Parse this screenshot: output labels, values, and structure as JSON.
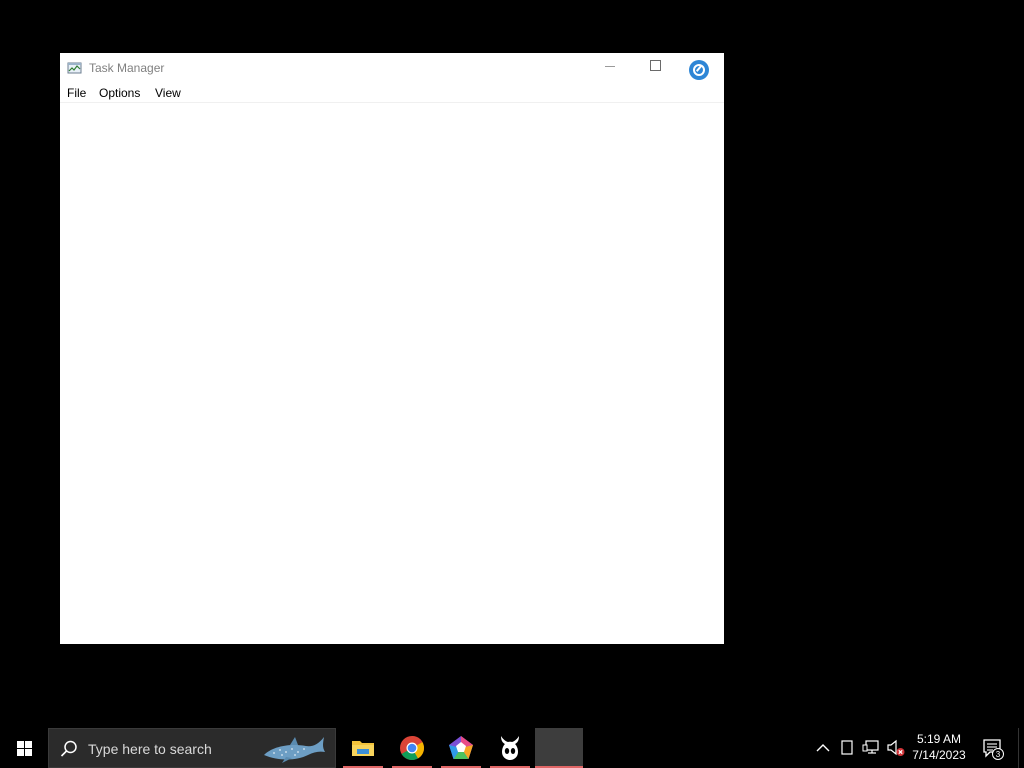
{
  "window": {
    "title": "Task Manager",
    "icon": "task-manager-icon",
    "menu": [
      "File",
      "Options",
      "View"
    ]
  },
  "taskbar": {
    "search_placeholder": "Type here to search",
    "apps": [
      {
        "name": "File Explorer",
        "icon": "folder-icon"
      },
      {
        "name": "Google Chrome",
        "icon": "chrome-icon"
      },
      {
        "name": "Pentagon App",
        "icon": "pentagon-app-icon"
      },
      {
        "name": "Hollow Knight",
        "icon": "knight-mask-icon"
      },
      {
        "name": "Task Manager",
        "icon": "task-manager-icon",
        "active": true
      }
    ],
    "clock": {
      "time": "5:19 AM",
      "date": "7/14/2023"
    },
    "notification_count": "3"
  },
  "colors": {
    "desktop": "#000000",
    "accent_close": "#2e86d6",
    "taskbar_underline": "#e06666"
  }
}
